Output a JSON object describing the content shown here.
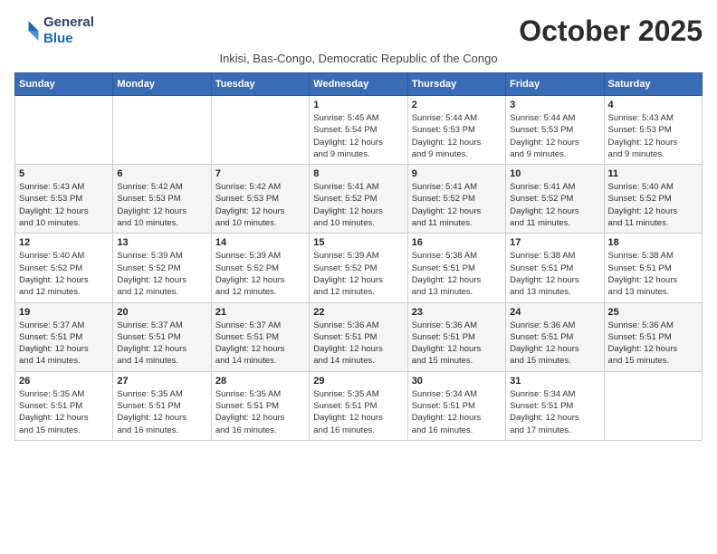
{
  "header": {
    "logo_line1": "General",
    "logo_line2": "Blue",
    "month_year": "October 2025",
    "subtitle": "Inkisi, Bas-Congo, Democratic Republic of the Congo"
  },
  "days_of_week": [
    "Sunday",
    "Monday",
    "Tuesday",
    "Wednesday",
    "Thursday",
    "Friday",
    "Saturday"
  ],
  "weeks": [
    [
      {
        "day": "",
        "info": ""
      },
      {
        "day": "",
        "info": ""
      },
      {
        "day": "",
        "info": ""
      },
      {
        "day": "1",
        "info": "Sunrise: 5:45 AM\nSunset: 5:54 PM\nDaylight: 12 hours\nand 9 minutes."
      },
      {
        "day": "2",
        "info": "Sunrise: 5:44 AM\nSunset: 5:53 PM\nDaylight: 12 hours\nand 9 minutes."
      },
      {
        "day": "3",
        "info": "Sunrise: 5:44 AM\nSunset: 5:53 PM\nDaylight: 12 hours\nand 9 minutes."
      },
      {
        "day": "4",
        "info": "Sunrise: 5:43 AM\nSunset: 5:53 PM\nDaylight: 12 hours\nand 9 minutes."
      }
    ],
    [
      {
        "day": "5",
        "info": "Sunrise: 5:43 AM\nSunset: 5:53 PM\nDaylight: 12 hours\nand 10 minutes."
      },
      {
        "day": "6",
        "info": "Sunrise: 5:42 AM\nSunset: 5:53 PM\nDaylight: 12 hours\nand 10 minutes."
      },
      {
        "day": "7",
        "info": "Sunrise: 5:42 AM\nSunset: 5:53 PM\nDaylight: 12 hours\nand 10 minutes."
      },
      {
        "day": "8",
        "info": "Sunrise: 5:41 AM\nSunset: 5:52 PM\nDaylight: 12 hours\nand 10 minutes."
      },
      {
        "day": "9",
        "info": "Sunrise: 5:41 AM\nSunset: 5:52 PM\nDaylight: 12 hours\nand 11 minutes."
      },
      {
        "day": "10",
        "info": "Sunrise: 5:41 AM\nSunset: 5:52 PM\nDaylight: 12 hours\nand 11 minutes."
      },
      {
        "day": "11",
        "info": "Sunrise: 5:40 AM\nSunset: 5:52 PM\nDaylight: 12 hours\nand 11 minutes."
      }
    ],
    [
      {
        "day": "12",
        "info": "Sunrise: 5:40 AM\nSunset: 5:52 PM\nDaylight: 12 hours\nand 12 minutes."
      },
      {
        "day": "13",
        "info": "Sunrise: 5:39 AM\nSunset: 5:52 PM\nDaylight: 12 hours\nand 12 minutes."
      },
      {
        "day": "14",
        "info": "Sunrise: 5:39 AM\nSunset: 5:52 PM\nDaylight: 12 hours\nand 12 minutes."
      },
      {
        "day": "15",
        "info": "Sunrise: 5:39 AM\nSunset: 5:52 PM\nDaylight: 12 hours\nand 12 minutes."
      },
      {
        "day": "16",
        "info": "Sunrise: 5:38 AM\nSunset: 5:51 PM\nDaylight: 12 hours\nand 13 minutes."
      },
      {
        "day": "17",
        "info": "Sunrise: 5:38 AM\nSunset: 5:51 PM\nDaylight: 12 hours\nand 13 minutes."
      },
      {
        "day": "18",
        "info": "Sunrise: 5:38 AM\nSunset: 5:51 PM\nDaylight: 12 hours\nand 13 minutes."
      }
    ],
    [
      {
        "day": "19",
        "info": "Sunrise: 5:37 AM\nSunset: 5:51 PM\nDaylight: 12 hours\nand 14 minutes."
      },
      {
        "day": "20",
        "info": "Sunrise: 5:37 AM\nSunset: 5:51 PM\nDaylight: 12 hours\nand 14 minutes."
      },
      {
        "day": "21",
        "info": "Sunrise: 5:37 AM\nSunset: 5:51 PM\nDaylight: 12 hours\nand 14 minutes."
      },
      {
        "day": "22",
        "info": "Sunrise: 5:36 AM\nSunset: 5:51 PM\nDaylight: 12 hours\nand 14 minutes."
      },
      {
        "day": "23",
        "info": "Sunrise: 5:36 AM\nSunset: 5:51 PM\nDaylight: 12 hours\nand 15 minutes."
      },
      {
        "day": "24",
        "info": "Sunrise: 5:36 AM\nSunset: 5:51 PM\nDaylight: 12 hours\nand 15 minutes."
      },
      {
        "day": "25",
        "info": "Sunrise: 5:36 AM\nSunset: 5:51 PM\nDaylight: 12 hours\nand 15 minutes."
      }
    ],
    [
      {
        "day": "26",
        "info": "Sunrise: 5:35 AM\nSunset: 5:51 PM\nDaylight: 12 hours\nand 15 minutes."
      },
      {
        "day": "27",
        "info": "Sunrise: 5:35 AM\nSunset: 5:51 PM\nDaylight: 12 hours\nand 16 minutes."
      },
      {
        "day": "28",
        "info": "Sunrise: 5:35 AM\nSunset: 5:51 PM\nDaylight: 12 hours\nand 16 minutes."
      },
      {
        "day": "29",
        "info": "Sunrise: 5:35 AM\nSunset: 5:51 PM\nDaylight: 12 hours\nand 16 minutes."
      },
      {
        "day": "30",
        "info": "Sunrise: 5:34 AM\nSunset: 5:51 PM\nDaylight: 12 hours\nand 16 minutes."
      },
      {
        "day": "31",
        "info": "Sunrise: 5:34 AM\nSunset: 5:51 PM\nDaylight: 12 hours\nand 17 minutes."
      },
      {
        "day": "",
        "info": ""
      }
    ]
  ]
}
